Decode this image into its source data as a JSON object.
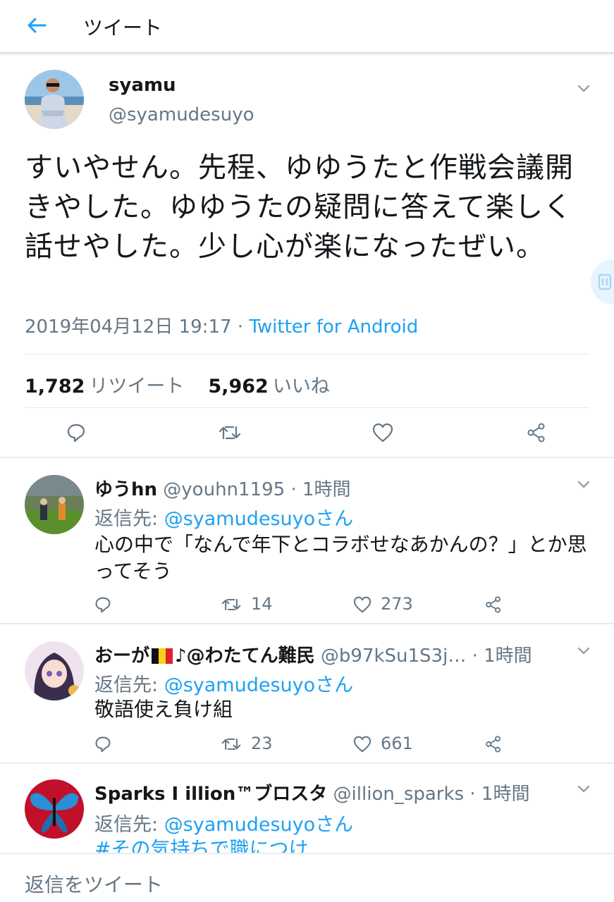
{
  "header": {
    "title": "ツイート",
    "back_icon": "arrow-left-icon"
  },
  "tweet": {
    "author_name": "syamu",
    "author_handle": "@syamudesuyo",
    "text": "すいやせん。先程、ゆゆうたと作戦会議開きやした。ゆゆうたの疑問に答えて楽しく話せやした。少し心が楽になったぜい。",
    "timestamp": "2019年04月12日 19:17 · ",
    "source": "Twitter for Android",
    "retweet_count": "1,782",
    "retweet_label": "リツイート",
    "like_count": "5,962",
    "like_label": "いいね"
  },
  "replies": [
    {
      "name": "ゆうhn",
      "handle_time": "@youhn1195 · 1時間",
      "reply_to_prefix": "返信先: ",
      "reply_to": "@syamudesuyoさん",
      "text": "心の中で「なんで年下とコラボせなあかんの？」とか思ってそう",
      "retweets": "14",
      "likes": "273"
    },
    {
      "name": "おーが",
      "name_suffix": "♪@わたてん難民",
      "handle_time": "@b97kSu1S3j… · 1時間",
      "reply_to_prefix": "返信先: ",
      "reply_to": "@syamudesuyoさん",
      "text": "敬語使え負け組",
      "retweets": "23",
      "likes": "661"
    },
    {
      "name": "Sparks I illion™ブロスタ",
      "handle_time": "@illion_sparks · 1時間",
      "reply_to_prefix": "返信先: ",
      "reply_to": "@syamudesuyoさん",
      "text": "#その気持ちで職につけ"
    }
  ],
  "composer": {
    "placeholder": "返信をツイート"
  },
  "colors": {
    "accent": "#1da1f2",
    "secondary_text": "#657786",
    "divider": "#e6ecf0"
  }
}
